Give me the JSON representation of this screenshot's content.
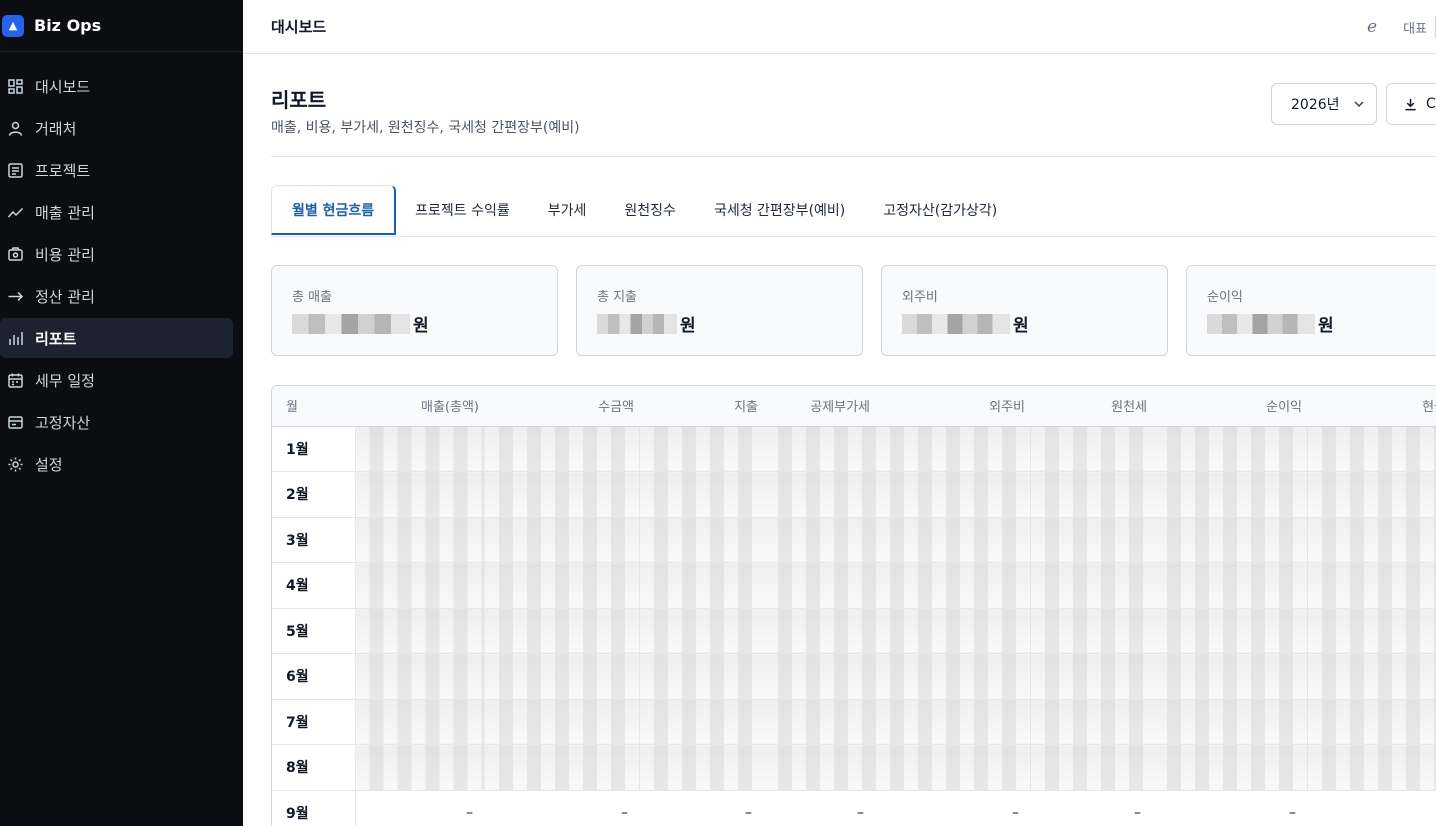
{
  "brand": {
    "name": "Biz Ops",
    "logo": "triangle-logo"
  },
  "sidebar": {
    "items": [
      {
        "label": "대시보드",
        "icon": "grid-icon",
        "active": false
      },
      {
        "label": "거래처",
        "icon": "user-icon",
        "active": false
      },
      {
        "label": "프로젝트",
        "icon": "list-icon",
        "active": false
      },
      {
        "label": "매출 관리",
        "icon": "trend-icon",
        "active": false
      },
      {
        "label": "비용 관리",
        "icon": "wallet-icon",
        "active": false
      },
      {
        "label": "정산 관리",
        "icon": "arrow-right-icon",
        "active": false
      },
      {
        "label": "리포트",
        "icon": "bar-chart-icon",
        "active": true
      },
      {
        "label": "세무 일정",
        "icon": "calendar-icon",
        "active": false
      },
      {
        "label": "고정자산",
        "icon": "asset-icon",
        "active": false
      },
      {
        "label": "설정",
        "icon": "gear-icon",
        "active": false
      }
    ]
  },
  "topbar": {
    "title": "대시보드",
    "user": "대표",
    "icon": "script-e-icon"
  },
  "page": {
    "title": "리포트",
    "subtitle": "매출, 비용, 부가세, 원천징수, 국세청 간편장부(예비)",
    "year": "2026년",
    "export_label": "C"
  },
  "tabs": [
    {
      "label": "월별 현금흐름",
      "active": true
    },
    {
      "label": "프로젝트 수익률",
      "active": false
    },
    {
      "label": "부가세",
      "active": false
    },
    {
      "label": "원천징수",
      "active": false
    },
    {
      "label": "국세청 간편장부(예비)",
      "active": false
    },
    {
      "label": "고정자산(감가상각)",
      "active": false
    }
  ],
  "cards": [
    {
      "label": "총 매출",
      "suffix": "원"
    },
    {
      "label": "총 지출",
      "suffix": "원"
    },
    {
      "label": "외주비",
      "suffix": "원"
    },
    {
      "label": "순이익",
      "suffix": "원"
    }
  ],
  "table": {
    "headers": [
      "월",
      "매출(총액)",
      "수금액",
      "지출",
      "공제부가세",
      "외주비",
      "원천세",
      "순이익",
      "현금"
    ],
    "rows": [
      {
        "month": "1월",
        "redacted": true
      },
      {
        "month": "2월",
        "redacted": true
      },
      {
        "month": "3월",
        "redacted": true
      },
      {
        "month": "4월",
        "redacted": true
      },
      {
        "month": "5월",
        "redacted": true
      },
      {
        "month": "6월",
        "redacted": true
      },
      {
        "month": "7월",
        "redacted": true
      },
      {
        "month": "8월",
        "redacted": true
      },
      {
        "month": "9월",
        "redacted": false,
        "cells": [
          "–",
          "–",
          "–",
          "–",
          "–",
          "–",
          "–",
          ""
        ]
      }
    ]
  }
}
